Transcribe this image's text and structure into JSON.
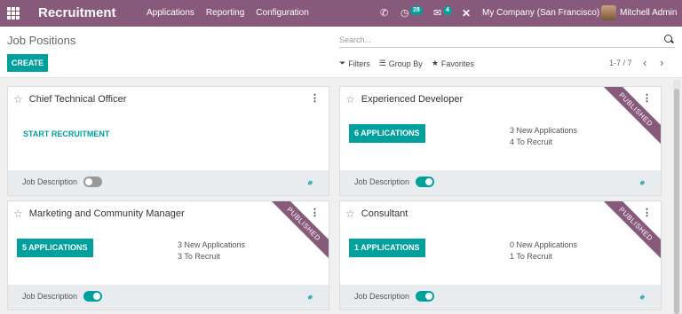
{
  "navbar": {
    "brand": "Recruitment",
    "menu": [
      "Applications",
      "Reporting",
      "Configuration"
    ],
    "activity_count": "28",
    "message_count": "4",
    "company": "My Company (San Francisco)",
    "user": "Mitchell Admin",
    "icons": [
      "apps-icon",
      "phone-icon",
      "activity-icon",
      "chat-icon",
      "debug-icon"
    ]
  },
  "control_panel": {
    "title": "Job Positions",
    "create_label": "CREATE",
    "search_placeholder": "Search...",
    "filters_label": "Filters",
    "groupby_label": "Group By",
    "favorites_label": "Favorites",
    "pager": "1-7 / 7"
  },
  "jobs": [
    {
      "title": "Chief Technical Officer",
      "published": false,
      "action": "START RECRUITMENT",
      "job_description_label": "Job Description",
      "job_description_enabled": false
    },
    {
      "title": "Experienced Developer",
      "published": true,
      "ribbon": "PUBLISHED",
      "action": "6 APPLICATIONS",
      "new_applications": "3 New Applications",
      "to_recruit": "4 To Recruit",
      "job_description_label": "Job Description",
      "job_description_enabled": true
    },
    {
      "title": "Marketing and Community Manager",
      "published": true,
      "ribbon": "PUBLISHED",
      "action": "5 APPLICATIONS",
      "new_applications": "3 New Applications",
      "to_recruit": "3 To Recruit",
      "job_description_label": "Job Description",
      "job_description_enabled": true
    },
    {
      "title": "Consultant",
      "published": true,
      "ribbon": "PUBLISHED",
      "action": "1 APPLICATIONS",
      "new_applications": "0 New Applications",
      "to_recruit": "1 To Recruit",
      "job_description_label": "Job Description",
      "job_description_enabled": true
    }
  ],
  "colors": {
    "brand": "#875a7b",
    "accent": "#00a09d"
  }
}
